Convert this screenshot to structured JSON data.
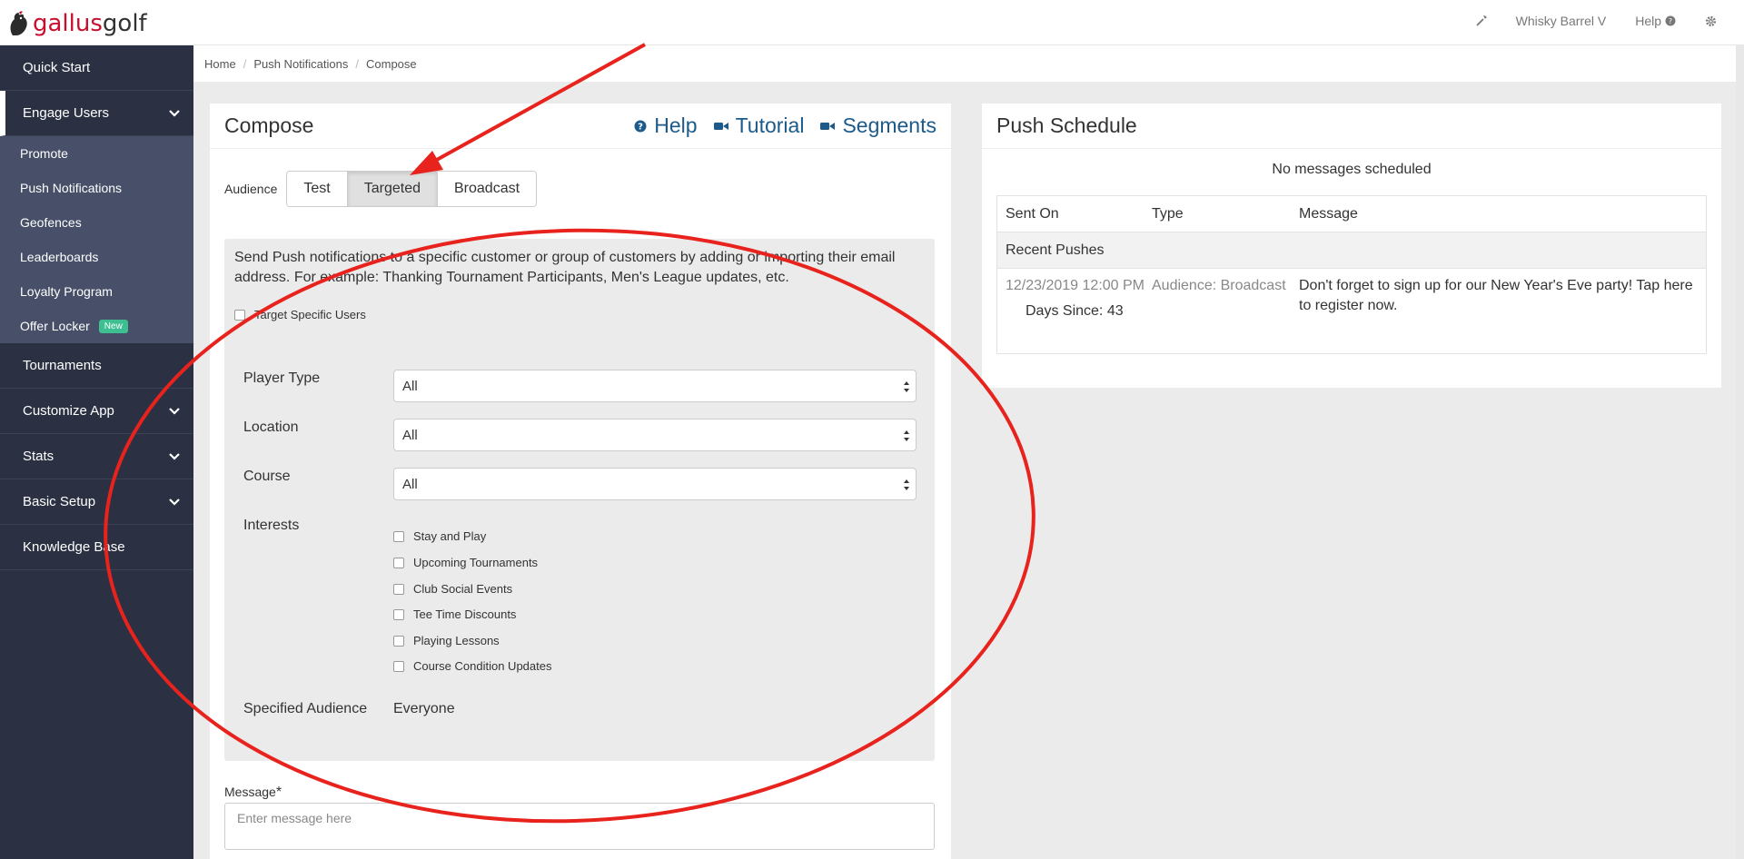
{
  "brand": {
    "part1": "gallus",
    "part2": "golf"
  },
  "topnav": {
    "user": "Whisky Barrel V",
    "help": "Help"
  },
  "sidebar": {
    "quick_start": "Quick Start",
    "engage": "Engage Users",
    "sub_items": [
      "Promote",
      "Push Notifications",
      "Geofences",
      "Leaderboards",
      "Loyalty Program",
      "Offer Locker"
    ],
    "new_badge": "New",
    "tournaments": "Tournaments",
    "customize": "Customize App",
    "stats": "Stats",
    "basic_setup": "Basic Setup",
    "knowledge": "Knowledge Base"
  },
  "breadcrumb": [
    "Home",
    "Push Notifications",
    "Compose"
  ],
  "compose": {
    "title": "Compose",
    "links": {
      "help": "Help",
      "tutorial": "Tutorial",
      "segments": "Segments"
    },
    "audience_label": "Audience",
    "audience_options": [
      "Test",
      "Targeted",
      "Broadcast"
    ],
    "audience_selected": "Targeted",
    "description": "Send Push notifications to a specific customer or group of customers by adding or importing their email address. For example: Thanking Tournament Participants, Men's League updates, etc.",
    "target_specific": "Target Specific Users",
    "player_type": {
      "label": "Player Type",
      "value": "All"
    },
    "location": {
      "label": "Location",
      "value": "All"
    },
    "course": {
      "label": "Course",
      "value": "All"
    },
    "interests_label": "Interests",
    "interests": [
      "Stay and Play",
      "Upcoming Tournaments",
      "Club Social Events",
      "Tee Time Discounts",
      "Playing Lessons",
      "Course Condition Updates"
    ],
    "specified_audience": {
      "label": "Specified Audience",
      "value": "Everyone"
    },
    "message_label": "Message",
    "message_required": "*",
    "message_placeholder": "Enter message here"
  },
  "schedule": {
    "title": "Push Schedule",
    "empty": "No messages scheduled",
    "columns": [
      "Sent On",
      "Type",
      "Message"
    ],
    "group": "Recent Pushes",
    "rows": [
      {
        "sent_on": "12/23/2019 12:00 PM",
        "days_since": "Days Since: 43",
        "type": "Audience: Broadcast",
        "message": "Don't forget to sign up for our New Year's Eve party! Tap here to register now."
      }
    ]
  },
  "colors": {
    "sidebar": "#2b3142",
    "sidebar_sub": "#485069",
    "link": "#1b5a8a",
    "brand_red": "#c8102e",
    "annotation": "#e8221c"
  }
}
